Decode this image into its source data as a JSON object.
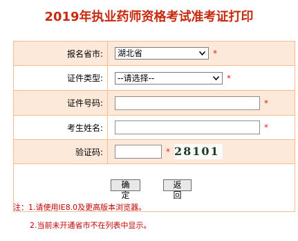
{
  "page": {
    "title": "2019年执业药师资格考试准考证打印"
  },
  "form": {
    "province": {
      "label": "报名省市:",
      "value": "湖北省",
      "required_mark": "*"
    },
    "id_type": {
      "label": "证件类型:",
      "value": "--请选择--",
      "required_mark": "*"
    },
    "id_number": {
      "label": "证件号码:",
      "value": "",
      "required_mark": "*"
    },
    "name": {
      "label": "考生姓名:",
      "value": "",
      "required_mark": "*"
    },
    "captcha": {
      "label": "验证码:",
      "value": "",
      "required_mark": "*",
      "image_text": "28101"
    }
  },
  "buttons": {
    "confirm": "确 定",
    "back": "返 回"
  },
  "notes": {
    "line1": "注：1.请使用IE8.0及更高版本浏览器。",
    "line2": "2.当前未开通省市不在列表中显示。"
  },
  "colors": {
    "title": "#c8290e",
    "row_shaded": "#fde9d9",
    "border": "#f3bb90",
    "required": "#e41b1b",
    "note": "#c00000"
  }
}
